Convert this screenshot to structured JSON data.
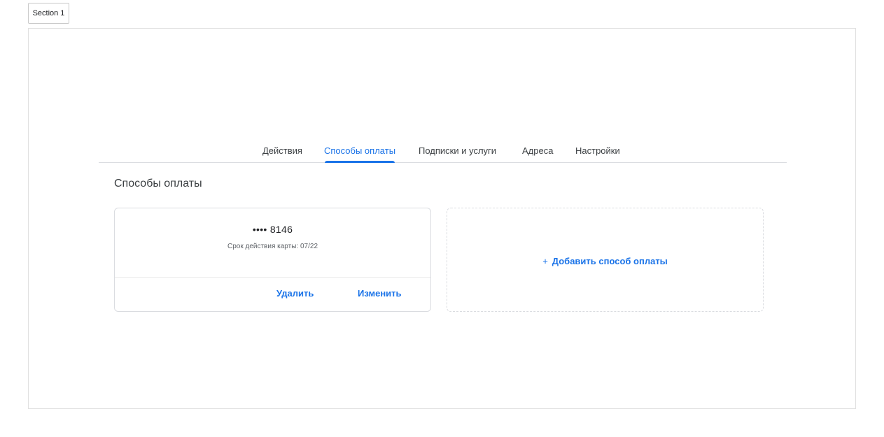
{
  "section_label": "Section 1",
  "tabs": [
    {
      "label": "Действия",
      "active": false
    },
    {
      "label": "Способы оплаты",
      "active": true
    },
    {
      "label": "Подписки и услуги",
      "active": false
    },
    {
      "label": "Адреса",
      "active": false
    },
    {
      "label": "Настройки",
      "active": false
    }
  ],
  "page_title": "Способы оплаты",
  "payment_card": {
    "masked_number": "•••• 8146",
    "expiry": "Срок действия карты: 07/22",
    "delete_label": "Удалить",
    "edit_label": "Изменить"
  },
  "add_payment": {
    "icon": "plus-icon",
    "plus_glyph": "+",
    "label": "Добавить способ оплаты"
  },
  "colors": {
    "accent": "#1a73e8",
    "text": "#3c4043",
    "border": "#dadce0"
  }
}
